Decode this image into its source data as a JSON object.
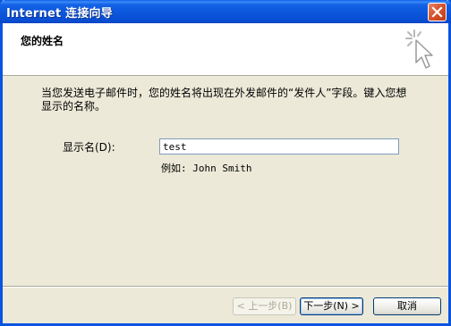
{
  "window": {
    "title": "Internet 连接向导"
  },
  "header": {
    "title": "您的姓名"
  },
  "body": {
    "intro": "当您发送电子邮件时，您的姓名将出现在外发邮件的“发件人”字段。键入您想显示的名称。",
    "field_label": "显示名(D):",
    "field_value": "test",
    "example": "例如: John Smith"
  },
  "buttons": {
    "back": "< 上一步(B)",
    "next": "下一步(N) >",
    "cancel": "取消"
  },
  "icons": {
    "close": "close-icon",
    "wizard": "cursor-sparkle-icon"
  },
  "colors": {
    "titlebar": "#0b55da",
    "dialog_bg": "#ece9d8",
    "header_bg": "#ffffff",
    "close_button": "#d7552f"
  }
}
